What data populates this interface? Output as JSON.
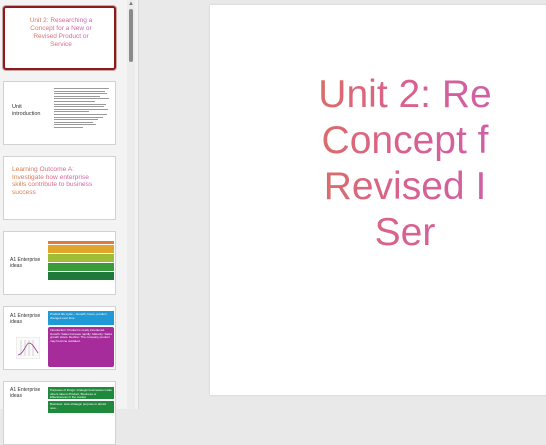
{
  "colors": {
    "title_gradient": [
      "#d97d3a",
      "#d9618f",
      "#c15fc7"
    ],
    "selected_border": "#8e1b1b",
    "table_header": "#e07b39",
    "table_rows": [
      "#e2a52b",
      "#9fbe36",
      "#3a9b3a",
      "#1f7a3a"
    ],
    "blue_panel": "#1f9ad6",
    "purple_panel": "#a52c9a",
    "green_panel": "#1f8a3b"
  },
  "slides": [
    {
      "title_lines": [
        "Unit 2: Researching a",
        "Concept for a New or",
        "Revised Product or",
        "Service"
      ]
    },
    {
      "label_lines": [
        "Unit",
        "introduction"
      ]
    },
    {
      "title_lines": [
        "Learning Outcome A:",
        "Investigate how enterprise",
        "skills contribute to business",
        "success"
      ]
    },
    {
      "label_lines": [
        "A1 Enterprise",
        "ideas"
      ]
    },
    {
      "label_lines": [
        "A1 Enterprise",
        "ideas"
      ],
      "blue_text": "Product life cycle – Growth, boom, product changes over time",
      "purple_text": "Introduction: Product is newly introduced. Growth: Sales increase rapidly. Maturity: Sales growth slows. Decline: The company product may become outdated."
    },
    {
      "label_lines": [
        "A1 Enterprise",
        "ideas"
      ],
      "green1_text": "Purposes of things: strategic businesses make others idea is Product, Business or Effectiveness in the market",
      "green2_text": "Business: How strategic purpose to attract new..."
    }
  ],
  "main_slide": {
    "title_lines": [
      "Unit 2: Re",
      "Concept f",
      "Revised I",
      "Ser"
    ]
  }
}
